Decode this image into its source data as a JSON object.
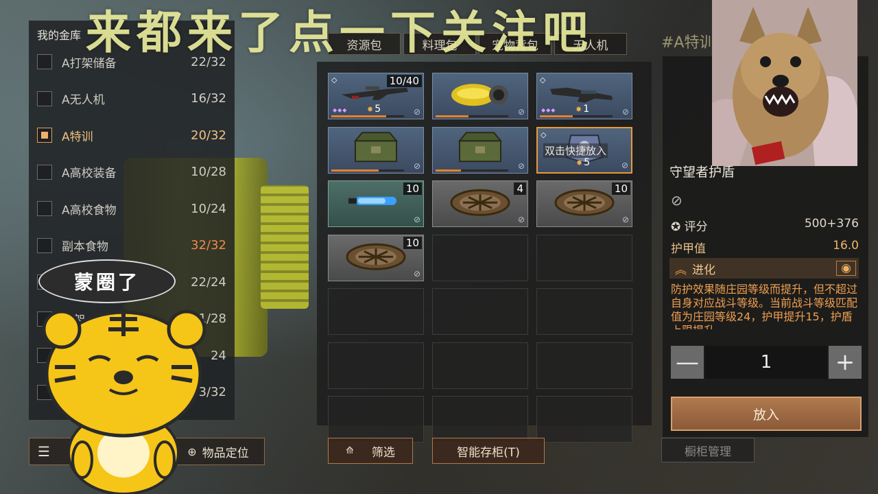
{
  "overlay_text": "来都来了点一下关注吧",
  "top_right_partial": "#A特训",
  "vault": {
    "title": "我的金库",
    "items": [
      {
        "name": "A打架储备",
        "count": "22/32",
        "checked": false
      },
      {
        "name": "A无人机",
        "count": "16/32",
        "checked": false
      },
      {
        "name": "A特训",
        "count": "20/32",
        "checked": true
      },
      {
        "name": "A高校装备",
        "count": "10/28",
        "checked": false
      },
      {
        "name": "A高校食物",
        "count": "10/24",
        "checked": false
      },
      {
        "name": "副本食物",
        "count": "32/32",
        "checked": false
      },
      {
        "name": "",
        "count": "22/24",
        "checked": false
      },
      {
        "name": "打架",
        "count": "1/28",
        "checked": false
      },
      {
        "name": "",
        "count": "24",
        "checked": false
      },
      {
        "name": "",
        "count": "3/32",
        "checked": false
      }
    ]
  },
  "bottom_left": {
    "btn1_label": "",
    "locate_label": "物品定位"
  },
  "tabs": [
    {
      "label": "资源包",
      "active": true
    },
    {
      "label": "料理包",
      "active": false
    },
    {
      "label": "宠物背包",
      "active": false
    },
    {
      "label": "无人机",
      "active": false
    }
  ],
  "grid": {
    "slots": [
      {
        "filled": true,
        "style": "filled",
        "count": "10/40",
        "gem": true,
        "stars": "◆◆◆",
        "level": "5",
        "progress": 0.75,
        "icon": "rifle"
      },
      {
        "filled": true,
        "style": "filled",
        "count": "",
        "gem": false,
        "stars": "",
        "level": "",
        "progress": 0.45,
        "icon": "jetpack"
      },
      {
        "filled": true,
        "style": "filled",
        "count": "",
        "gem": true,
        "stars": "◆◆◆",
        "level": "1",
        "progress": 0.45,
        "icon": "rifle2"
      },
      {
        "filled": true,
        "style": "filled",
        "count": "",
        "gem": false,
        "stars": "",
        "level": "",
        "progress": 0.65,
        "icon": "crate"
      },
      {
        "filled": true,
        "style": "filled",
        "count": "",
        "gem": false,
        "stars": "",
        "level": "",
        "progress": 0.35,
        "icon": "crate"
      },
      {
        "filled": true,
        "style": "filled",
        "count": "",
        "gem": true,
        "stars": "",
        "level": "5",
        "progress": 0.0,
        "icon": "armor",
        "selected": true,
        "tooltip": "双击快捷放入"
      },
      {
        "filled": true,
        "style": "green",
        "count": "10",
        "gem": false,
        "stars": "",
        "level": "",
        "progress": 0,
        "icon": "capsule"
      },
      {
        "filled": true,
        "style": "gray",
        "count": "4",
        "gem": false,
        "stars": "",
        "level": "",
        "progress": 0,
        "icon": "trap"
      },
      {
        "filled": true,
        "style": "gray",
        "count": "10",
        "gem": false,
        "stars": "",
        "level": "",
        "progress": 0,
        "icon": "trap"
      },
      {
        "filled": true,
        "style": "gray",
        "count": "10",
        "gem": false,
        "stars": "",
        "level": "",
        "progress": 0,
        "icon": "trap"
      },
      {
        "filled": false
      },
      {
        "filled": false
      },
      {
        "filled": false
      },
      {
        "filled": false
      },
      {
        "filled": false
      },
      {
        "filled": false
      },
      {
        "filled": false
      },
      {
        "filled": false
      },
      {
        "filled": false
      },
      {
        "filled": false
      },
      {
        "filled": false
      }
    ]
  },
  "filter_label": "筛选",
  "smart_store_label": "智能存柜(T)",
  "detail": {
    "name": "守望者护盾",
    "rating_label": "评分",
    "rating_value": "500+376",
    "armor_label": "护甲值",
    "armor_value": "16.0",
    "evolve_label": "进化",
    "description": "防护效果随庄园等级而提升，但不超过自身对应战斗等级。当前战斗等级匹配值为庄园等级24，护甲提升15，护盾上限提升",
    "quantity": "1",
    "minus": "—",
    "plus": "+",
    "place_label": "放入"
  },
  "cabinet_label": "橱柜管理",
  "mascot_speech": "蒙圈了",
  "colors": {
    "accent": "#e89a3a",
    "full_count": "#f08a4a",
    "banner": "#e8ea9a"
  }
}
